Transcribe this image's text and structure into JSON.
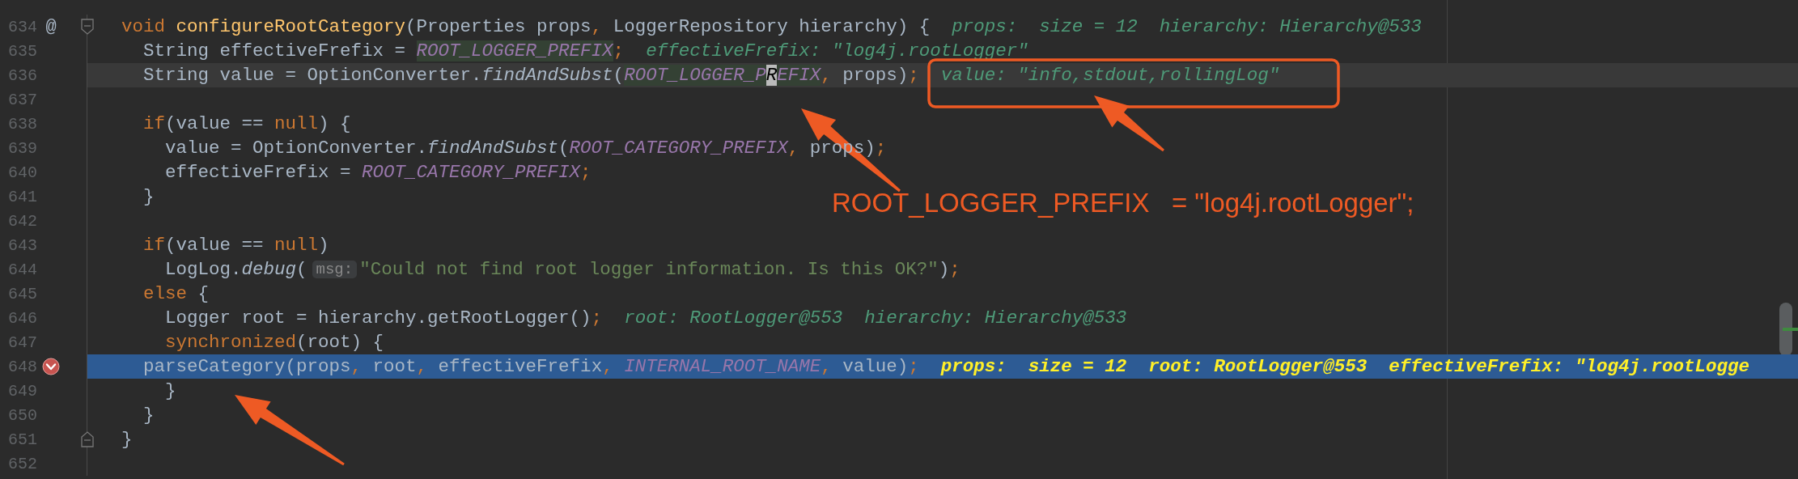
{
  "editor": {
    "lines": [
      {
        "number": "634",
        "gutter_mark": "@",
        "breakpoint": false,
        "fold": {
          "kind": "start"
        },
        "caret_line": false,
        "execution_point": false,
        "parts": [
          {
            "kind": "code",
            "tokens": [
              {
                "t": "void ",
                "kind": "keyword"
              },
              {
                "t": "configureRootCategory",
                "kind": "declaration"
              },
              {
                "t": "(Properties props",
                "kind": "plain"
              },
              {
                "t": ",",
                "kind": "punct"
              },
              {
                "t": " LoggerRepository hierarchy) {",
                "kind": "plain"
              }
            ]
          },
          {
            "kind": "inline_value",
            "text": "props:  size = 12  hierarchy: Hierarchy@533"
          }
        ]
      },
      {
        "number": "635",
        "breakpoint": false,
        "caret_line": false,
        "execution_point": false,
        "parts": [
          {
            "kind": "code",
            "tokens": [
              {
                "t": "  String effectiveFrefix = ",
                "kind": "plain"
              },
              {
                "t": "ROOT_LOGGER_PREFIX",
                "kind": "constant_usage"
              },
              {
                "t": ";",
                "kind": "punct"
              }
            ]
          },
          {
            "kind": "inline_value",
            "text": "effectiveFrefix: \"log4j.rootLogger\""
          }
        ]
      },
      {
        "number": "636",
        "breakpoint": false,
        "caret_line": true,
        "execution_point": false,
        "parts": [
          {
            "kind": "code",
            "tokens": [
              {
                "t": "  String value = OptionConverter.",
                "kind": "plain"
              },
              {
                "t": "findAndSubst",
                "kind": "method"
              },
              {
                "t": "(",
                "kind": "plain"
              },
              {
                "t": "ROOT_LOGGER_P",
                "kind": "constant_usage"
              },
              {
                "t": "R",
                "kind": "caret"
              },
              {
                "t": "EFIX",
                "kind": "constant_usage"
              },
              {
                "t": ",",
                "kind": "punct"
              },
              {
                "t": " props)",
                "kind": "plain"
              },
              {
                "t": ";",
                "kind": "punct"
              }
            ]
          },
          {
            "kind": "inline_value",
            "text": "value: \"info,stdout,rollingLog\""
          }
        ]
      },
      {
        "number": "637",
        "breakpoint": false,
        "caret_line": false,
        "execution_point": false
      },
      {
        "number": "638",
        "breakpoint": false,
        "caret_line": false,
        "execution_point": false,
        "parts": [
          {
            "kind": "code",
            "tokens": [
              {
                "t": "  if",
                "kind": "keyword"
              },
              {
                "t": "(value == ",
                "kind": "plain"
              },
              {
                "t": "null",
                "kind": "keyword"
              },
              {
                "t": ") {",
                "kind": "plain"
              }
            ]
          }
        ]
      },
      {
        "number": "639",
        "breakpoint": false,
        "caret_line": false,
        "execution_point": false,
        "parts": [
          {
            "kind": "code",
            "tokens": [
              {
                "t": "    value = OptionConverter.",
                "kind": "plain"
              },
              {
                "t": "findAndSubst",
                "kind": "method"
              },
              {
                "t": "(",
                "kind": "plain"
              },
              {
                "t": "ROOT_CATEGORY_PREFIX",
                "kind": "constant"
              },
              {
                "t": ",",
                "kind": "punct"
              },
              {
                "t": " props)",
                "kind": "plain"
              },
              {
                "t": ";",
                "kind": "punct"
              }
            ]
          }
        ]
      },
      {
        "number": "640",
        "breakpoint": false,
        "caret_line": false,
        "execution_point": false,
        "parts": [
          {
            "kind": "code",
            "tokens": [
              {
                "t": "    effectiveFrefix = ",
                "kind": "plain"
              },
              {
                "t": "ROOT_CATEGORY_PREFIX",
                "kind": "constant"
              },
              {
                "t": ";",
                "kind": "punct"
              }
            ]
          }
        ]
      },
      {
        "number": "641",
        "breakpoint": false,
        "caret_line": false,
        "execution_point": false,
        "parts": [
          {
            "kind": "code",
            "tokens": [
              {
                "t": "  }",
                "kind": "plain"
              }
            ]
          }
        ]
      },
      {
        "number": "642",
        "breakpoint": false,
        "caret_line": false,
        "execution_point": false
      },
      {
        "number": "643",
        "breakpoint": false,
        "caret_line": false,
        "execution_point": false,
        "parts": [
          {
            "kind": "code",
            "tokens": [
              {
                "t": "  if",
                "kind": "keyword"
              },
              {
                "t": "(value == ",
                "kind": "plain"
              },
              {
                "t": "null",
                "kind": "keyword"
              },
              {
                "t": ")",
                "kind": "plain"
              }
            ]
          }
        ]
      },
      {
        "number": "644",
        "breakpoint": false,
        "caret_line": false,
        "execution_point": false,
        "parts": [
          {
            "kind": "code",
            "tokens": [
              {
                "t": "    LogLog.",
                "kind": "plain"
              },
              {
                "t": "debug",
                "kind": "method"
              },
              {
                "t": "(",
                "kind": "plain"
              }
            ]
          },
          {
            "kind": "parameter_hint",
            "text": "msg:"
          },
          {
            "kind": "code",
            "tokens": [
              {
                "t": "\"Could not find root logger information. Is this OK?\"",
                "kind": "string"
              },
              {
                "t": ")",
                "kind": "plain"
              },
              {
                "t": ";",
                "kind": "punct"
              }
            ]
          }
        ]
      },
      {
        "number": "645",
        "breakpoint": false,
        "caret_line": false,
        "execution_point": false,
        "parts": [
          {
            "kind": "code",
            "tokens": [
              {
                "t": "  else",
                "kind": "keyword"
              },
              {
                "t": " {",
                "kind": "plain"
              }
            ]
          }
        ]
      },
      {
        "number": "646",
        "breakpoint": false,
        "caret_line": false,
        "execution_point": false,
        "parts": [
          {
            "kind": "code",
            "tokens": [
              {
                "t": "    Logger root = hierarchy.getRootLogger()",
                "kind": "plain"
              },
              {
                "t": ";",
                "kind": "punct"
              }
            ]
          },
          {
            "kind": "inline_value",
            "text": "root: RootLogger@553  hierarchy: Hierarchy@533"
          }
        ]
      },
      {
        "number": "647",
        "breakpoint": false,
        "caret_line": false,
        "execution_point": false,
        "parts": [
          {
            "kind": "code",
            "tokens": [
              {
                "t": "    synchronized",
                "kind": "keyword"
              },
              {
                "t": "(root) {",
                "kind": "plain"
              }
            ]
          }
        ]
      },
      {
        "number": "648",
        "breakpoint": true,
        "caret_line": false,
        "execution_point": true,
        "parts": [
          {
            "kind": "code",
            "tokens": [
              {
                "t": "  parseCategory(props",
                "kind": "plain"
              },
              {
                "t": ",",
                "kind": "punct"
              },
              {
                "t": " root",
                "kind": "plain"
              },
              {
                "t": ",",
                "kind": "punct"
              },
              {
                "t": " effectiveFrefix",
                "kind": "plain"
              },
              {
                "t": ",",
                "kind": "punct"
              },
              {
                "t": " INTERNAL_ROOT_NAME",
                "kind": "constant"
              },
              {
                "t": ",",
                "kind": "punct"
              },
              {
                "t": " value)",
                "kind": "plain"
              },
              {
                "t": ";",
                "kind": "punct"
              }
            ]
          },
          {
            "kind": "inline_value",
            "text": "props:  size = 12  root: RootLogger@553  effectiveFrefix: \"log4j.rootLogge"
          }
        ]
      },
      {
        "number": "649",
        "breakpoint": false,
        "caret_line": false,
        "execution_point": false,
        "parts": [
          {
            "kind": "code",
            "tokens": [
              {
                "t": "    }",
                "kind": "plain"
              }
            ]
          }
        ]
      },
      {
        "number": "650",
        "breakpoint": false,
        "caret_line": false,
        "execution_point": false,
        "parts": [
          {
            "kind": "code",
            "tokens": [
              {
                "t": "  }",
                "kind": "plain"
              }
            ]
          }
        ]
      },
      {
        "number": "651",
        "breakpoint": false,
        "fold": {
          "kind": "end"
        },
        "caret_line": false,
        "execution_point": false,
        "parts": [
          {
            "kind": "code",
            "tokens": [
              {
                "t": "}",
                "kind": "plain"
              }
            ]
          }
        ]
      },
      {
        "number": "652",
        "breakpoint": false,
        "caret_line": false,
        "execution_point": false
      }
    ]
  },
  "annotation": {
    "note": "ROOT_LOGGER_PREFIX   = \"log4j.rootLogger\";"
  }
}
